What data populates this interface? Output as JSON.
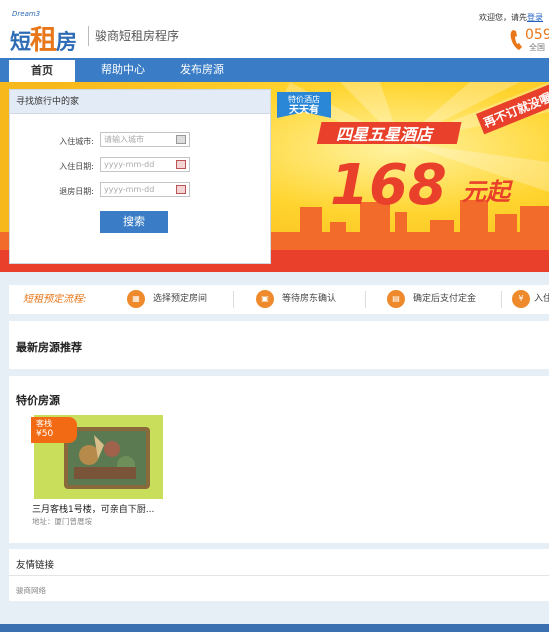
{
  "header": {
    "logo_small": "Dream3",
    "logo_text_a": "短",
    "logo_text_b": "租",
    "logo_text_c": "房",
    "slogan": "骏商短租房程序",
    "welcome_text": "欢迎您，请先",
    "login_link": "登录",
    "hotline_number": "059",
    "hotline_sub": "全国"
  },
  "nav": {
    "items": [
      {
        "label": "首页",
        "active": true
      },
      {
        "label": "帮助中心",
        "active": false
      },
      {
        "label": "发布房源",
        "active": false
      }
    ]
  },
  "search": {
    "title": "寻找旅行中的家",
    "city_label": "入住城市:",
    "city_placeholder": "请输入城市",
    "checkin_label": "入住日期:",
    "checkin_placeholder": "yyyy-mm-dd",
    "checkout_label": "退房日期:",
    "checkout_placeholder": "yyyy-mm-dd",
    "button_label": "搜索"
  },
  "banner": {
    "ribbon_line1": "特价酒店",
    "ribbon_line2": "天天有",
    "headline": "四星五星酒店",
    "price": "168",
    "price_suffix": "元起",
    "badge": "再不订就没喔"
  },
  "flow": {
    "title": "短租预定流程:",
    "steps": [
      "选择预定房间",
      "等待房东确认",
      "确定后支付定金",
      "入住"
    ]
  },
  "sections": {
    "latest_title": "最新房源推荐",
    "special_title": "特价房源",
    "links_title": "友情链接"
  },
  "listing": {
    "tag_type": "客栈",
    "tag_price": "¥50",
    "title": "三月客栈1号楼，可亲自下厨...",
    "address": "地址：厦门曾厝垵"
  },
  "links": {
    "items": [
      "骏商网络"
    ]
  },
  "colors": {
    "brand_blue": "#3a7dc6",
    "accent_orange": "#e8771a",
    "banner_yellow": "#ffd42e",
    "banner_red": "#e8402a"
  }
}
